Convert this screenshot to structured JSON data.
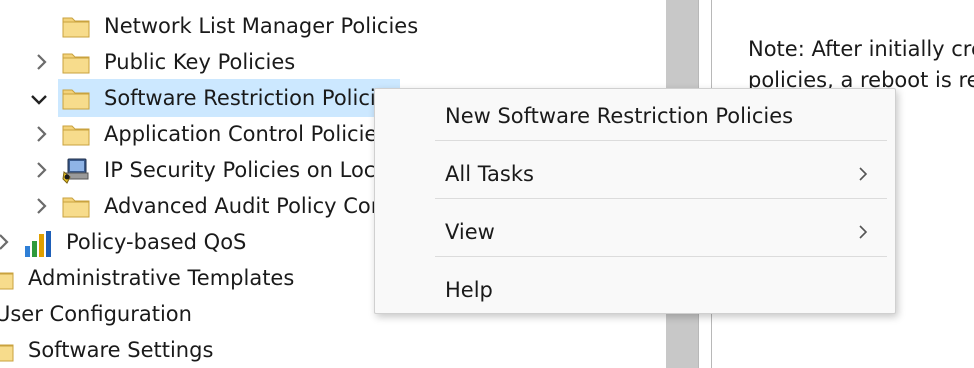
{
  "tree": {
    "items": [
      {
        "label": "Network List Manager Policies",
        "icon": "folder-icon",
        "expander": "none"
      },
      {
        "label": "Public Key Policies",
        "icon": "folder-icon",
        "expander": "chevron-right-icon"
      },
      {
        "label": "Software Restriction Policies",
        "icon": "folder-icon",
        "expander": "chevron-down-icon",
        "selected": true
      },
      {
        "label": "Application Control Policies",
        "icon": "folder-icon",
        "expander": "chevron-right-icon"
      },
      {
        "label": "IP Security Policies on Local Computer",
        "icon": "ip-security-icon",
        "expander": "chevron-right-icon"
      },
      {
        "label": "Advanced Audit Policy Configuration",
        "icon": "folder-icon",
        "expander": "chevron-right-icon"
      },
      {
        "label": "Policy-based QoS",
        "icon": "bar-chart-icon",
        "expander": "chevron-right-icon"
      },
      {
        "label": "Administrative Templates",
        "icon": "folder-icon",
        "expander": "none"
      },
      {
        "label": "User Configuration",
        "icon": "none",
        "expander": "none"
      },
      {
        "label": "Software Settings",
        "icon": "folder-icon",
        "expander": "none"
      }
    ]
  },
  "right_pane": {
    "note_line1": "Note: After initially cre",
    "note_line2": "policies, a reboot is rec"
  },
  "context_menu": {
    "items": [
      {
        "label": "New Software Restriction Policies",
        "submenu": false
      },
      {
        "label": "All Tasks",
        "submenu": true
      },
      {
        "label": "View",
        "submenu": true
      },
      {
        "label": "Help",
        "submenu": false
      }
    ]
  },
  "colors": {
    "selection": "#cce8ff",
    "folder": "#f3d27a",
    "menu_bg": "#f9f9f9",
    "scrollbar": "#c8c8c8"
  }
}
